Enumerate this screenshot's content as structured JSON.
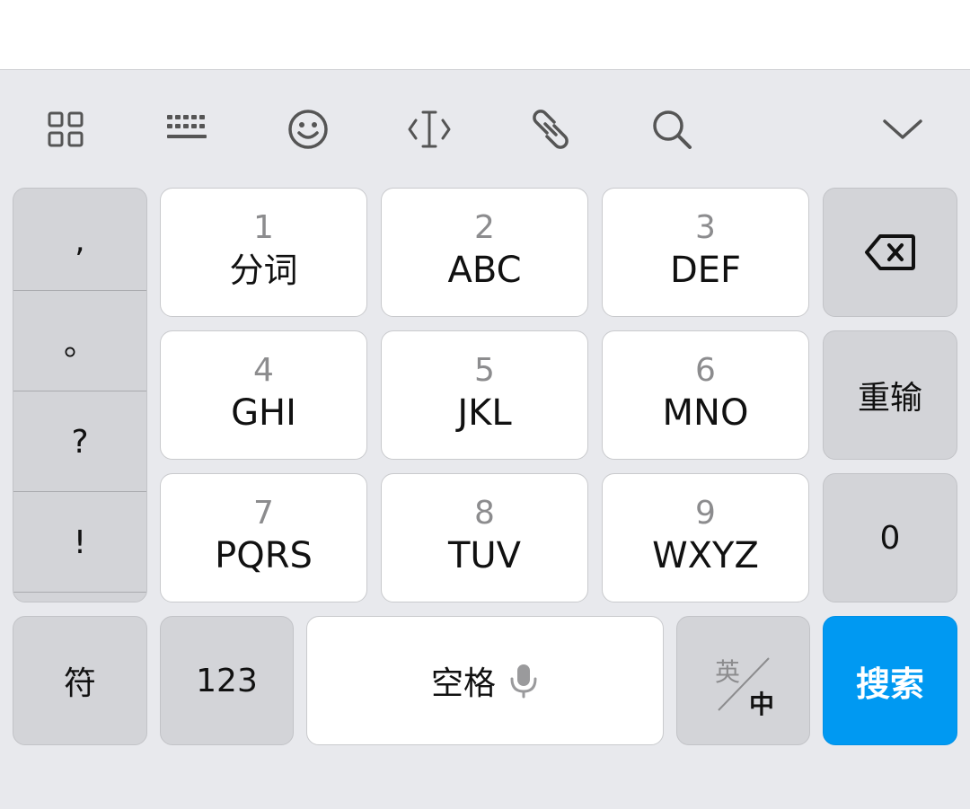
{
  "toolbar": {
    "icons": [
      "grid-icon",
      "keyboard-icon",
      "emoji-icon",
      "cursor-icon",
      "clipboard-link-icon",
      "search-icon",
      "chevron-down-icon"
    ]
  },
  "punctuation": [
    ",",
    "。",
    "?",
    "!"
  ],
  "keys": [
    {
      "digit": "1",
      "letters": "分词"
    },
    {
      "digit": "2",
      "letters": "ABC"
    },
    {
      "digit": "3",
      "letters": "DEF"
    },
    {
      "digit": "4",
      "letters": "GHI"
    },
    {
      "digit": "5",
      "letters": "JKL"
    },
    {
      "digit": "6",
      "letters": "MNO"
    },
    {
      "digit": "7",
      "letters": "PQRS"
    },
    {
      "digit": "8",
      "letters": "TUV"
    },
    {
      "digit": "9",
      "letters": "WXYZ"
    }
  ],
  "side": {
    "backspace_icon": "backspace-icon",
    "reset_label": "重输",
    "zero_label": "0"
  },
  "bottom_row": {
    "symbols_label": "符",
    "numbers_label": "123",
    "space_label": "空格",
    "mic_icon": "microphone-icon",
    "lang_top": "英",
    "lang_bottom": "中",
    "search_label": "搜索",
    "search_color": "#0099f2"
  }
}
